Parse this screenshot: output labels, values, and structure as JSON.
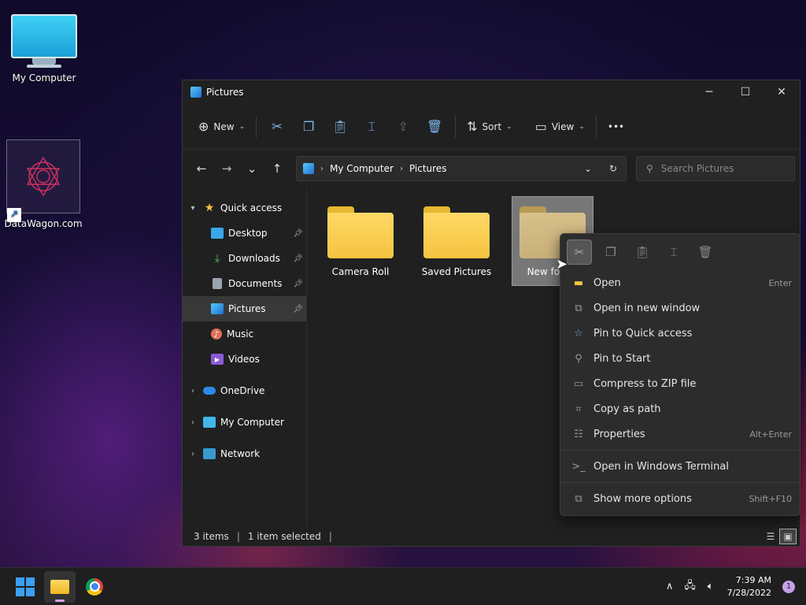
{
  "desktop": {
    "icons": [
      {
        "label": "My Computer"
      },
      {
        "label": "DataWagon.com"
      }
    ]
  },
  "window": {
    "title": "Pictures",
    "controls": {
      "minimize": "─",
      "maximize": "☐",
      "close": "✕"
    }
  },
  "toolbar": {
    "new_label": "New",
    "sort_label": "Sort",
    "view_label": "View",
    "more_label": "•••"
  },
  "address": {
    "crumbs": [
      "My Computer",
      "Pictures"
    ]
  },
  "search": {
    "placeholder": "Search Pictures"
  },
  "nav": {
    "quick_access": "Quick access",
    "items": [
      {
        "label": "Desktop"
      },
      {
        "label": "Downloads"
      },
      {
        "label": "Documents"
      },
      {
        "label": "Pictures"
      },
      {
        "label": "Music"
      },
      {
        "label": "Videos"
      }
    ],
    "onedrive": "OneDrive",
    "my_computer": "My Computer",
    "network": "Network"
  },
  "folders": [
    {
      "label": "Camera Roll"
    },
    {
      "label": "Saved Pictures"
    },
    {
      "label": "New folder"
    }
  ],
  "status": {
    "items": "3 items",
    "selected": "1 item selected"
  },
  "context_menu": {
    "items": [
      {
        "label": "Open",
        "shortcut": "Enter"
      },
      {
        "label": "Open in new window",
        "shortcut": ""
      },
      {
        "label": "Pin to Quick access",
        "shortcut": ""
      },
      {
        "label": "Pin to Start",
        "shortcut": ""
      },
      {
        "label": "Compress to ZIP file",
        "shortcut": ""
      },
      {
        "label": "Copy as path",
        "shortcut": ""
      },
      {
        "label": "Properties",
        "shortcut": "Alt+Enter"
      },
      {
        "label": "Open in Windows Terminal",
        "shortcut": ""
      },
      {
        "label": "Show more options",
        "shortcut": "Shift+F10"
      }
    ]
  },
  "taskbar": {
    "time": "7:39 AM",
    "date": "7/28/2022",
    "notifications": "1"
  },
  "colors": {
    "accent": "#3aa0f5",
    "folder": "#f5c440",
    "window_bg": "#202020"
  }
}
